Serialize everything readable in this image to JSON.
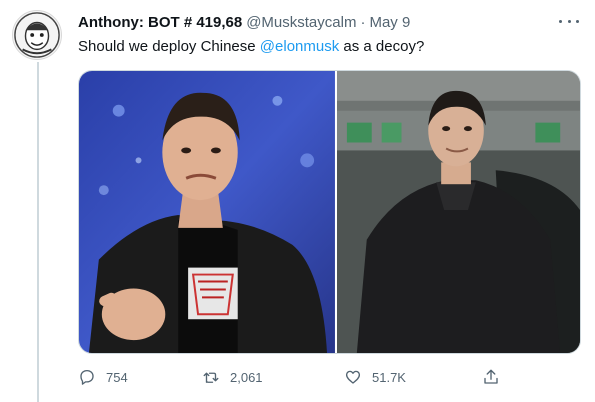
{
  "tweet": {
    "display_name": "Anthony: BOT # 419,68",
    "handle": "@Muskstaycalm",
    "separator": "·",
    "date": "May 9",
    "text_before": "Should we deploy Chinese ",
    "mention": "@elonmusk",
    "text_after": " as a decoy?"
  },
  "actions": {
    "reply_count": "754",
    "retweet_count": "2,061",
    "like_count": "51.7K"
  },
  "icons": {
    "avatar": "avatar",
    "more": "more-icon",
    "reply": "reply-icon",
    "retweet": "retweet-icon",
    "like": "heart-icon",
    "share": "share-icon"
  },
  "colors": {
    "mention": "#1d9bf0",
    "secondary_text": "#536471"
  }
}
